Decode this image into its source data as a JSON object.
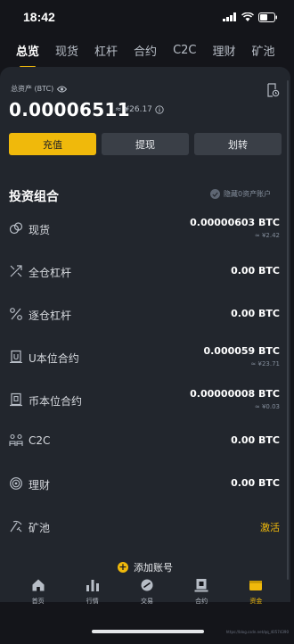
{
  "status_bar": {
    "time": "18:42"
  },
  "top_tabs": [
    {
      "label": "总览",
      "active": true
    },
    {
      "label": "现货"
    },
    {
      "label": "杠杆"
    },
    {
      "label": "合约"
    },
    {
      "label": "C2C"
    },
    {
      "label": "理财"
    },
    {
      "label": "矿池"
    }
  ],
  "overview": {
    "total_label": "总资产 (BTC)",
    "total_btc": "0.00006511",
    "total_cny": "≈ ¥26.17",
    "buttons": {
      "deposit": "充值",
      "withdraw": "提现",
      "transfer": "划转"
    }
  },
  "portfolio": {
    "title": "投资组合",
    "hide_zero_label": "隐藏0资产账户",
    "rows": [
      {
        "name": "现货",
        "amount": "0.00000603 BTC",
        "sub": "≈ ¥2.42",
        "icon": "spot-icon"
      },
      {
        "name": "全仓杠杆",
        "amount": "0.00 BTC",
        "sub": "",
        "icon": "cross-margin-icon"
      },
      {
        "name": "逐仓杠杆",
        "amount": "0.00 BTC",
        "sub": "",
        "icon": "isolated-margin-icon"
      },
      {
        "name": "U本位合约",
        "amount": "0.000059 BTC",
        "sub": "≈ ¥23.71",
        "icon": "usdm-futures-icon"
      },
      {
        "name": "币本位合约",
        "amount": "0.00000008 BTC",
        "sub": "≈ ¥0.03",
        "icon": "coinm-futures-icon"
      },
      {
        "name": "C2C",
        "amount": "0.00 BTC",
        "sub": "",
        "icon": "c2c-icon"
      },
      {
        "name": "理财",
        "amount": "0.00 BTC",
        "sub": "",
        "icon": "earn-icon"
      },
      {
        "name": "矿池",
        "amount": "激活",
        "sub": "",
        "icon": "pool-icon",
        "link": true
      }
    ],
    "add_account_label": "添加账号"
  },
  "bottom_nav": [
    {
      "label": "首页",
      "icon": "home-icon"
    },
    {
      "label": "行情",
      "icon": "markets-icon"
    },
    {
      "label": "交易",
      "icon": "trade-icon"
    },
    {
      "label": "合约",
      "icon": "futures-icon"
    },
    {
      "label": "资金",
      "icon": "wallet-icon",
      "active": true
    }
  ],
  "watermark": "https://blog.csdn.net/qq_40574390",
  "colors": {
    "accent": "#f0b90b",
    "background": "#14151a",
    "card": "#22262d",
    "button": "#3a3f47"
  }
}
